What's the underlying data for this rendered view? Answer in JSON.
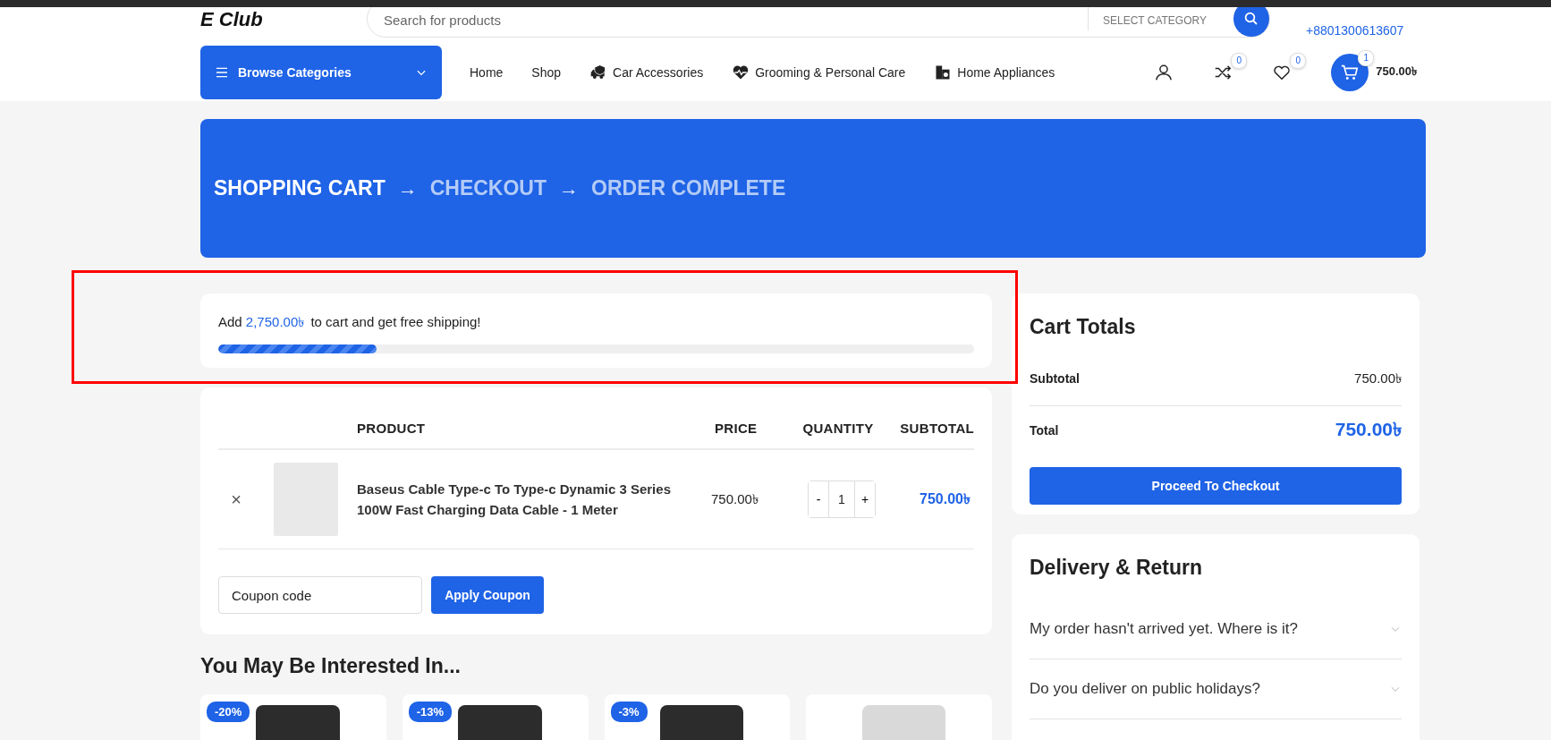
{
  "header": {
    "logo": "E Club",
    "search": {
      "placeholder": "Search for products"
    },
    "category_select": "SELECT CATEGORY",
    "phone": "+8801300613607"
  },
  "nav": {
    "browse": "Browse Categories",
    "links": [
      {
        "label": "Home"
      },
      {
        "label": "Shop"
      },
      {
        "label": "Car Accessories"
      },
      {
        "label": "Grooming & Personal Care"
      },
      {
        "label": "Home Appliances"
      }
    ],
    "compare_count": "0",
    "wishlist_count": "0",
    "cart_count": "1",
    "cart_total": "750.00৳"
  },
  "steps": [
    {
      "label": "SHOPPING CART",
      "selected": true
    },
    {
      "label": "CHECKOUT",
      "selected": false
    },
    {
      "label": "ORDER COMPLETE",
      "selected": false
    }
  ],
  "step_separator": "→",
  "shipping": {
    "before": "Add ",
    "amount": "2,750.00৳",
    "after": " to cart and get free shipping!",
    "level": 0.21
  },
  "cart": {
    "columns": [
      "PRODUCT",
      "PRICE",
      "QUANTITY",
      "SUBTOTAL"
    ],
    "rows": [
      {
        "remove": "×",
        "name": "Baseus Cable Type-c To Type-c Dynamic 3 Series 100W Fast Charging Data Cable - 1 Meter",
        "price": "750.00৳",
        "minus": "-",
        "quantity": "1",
        "plus": "+",
        "subtotal": "750.00৳"
      }
    ],
    "coupon": {
      "placeholder": "Coupon code"
    },
    "apply": "Apply Coupon"
  },
  "related": {
    "title": "You May Be Interested In...",
    "products": [
      {
        "kind": "sale",
        "badge": "-20%"
      },
      {
        "kind": "sale",
        "badge": "-13%"
      },
      {
        "kind": "sale",
        "badge": "-3%"
      },
      {
        "kind": "regular"
      }
    ]
  },
  "totals": {
    "title": "Cart Totals",
    "subtotal_label": "Subtotal",
    "subtotal": "750.00৳",
    "total_label": "Total",
    "total": "750.00৳",
    "checkout": "Proceed To Checkout"
  },
  "delivery": {
    "title": "Delivery & Return",
    "faqs": [
      {
        "question": "My order hasn't arrived yet. Where is it?",
        "expanded": false
      },
      {
        "question": "Do you deliver on public holidays?",
        "expanded": false
      }
    ]
  },
  "annotation": {
    "shown": true
  }
}
